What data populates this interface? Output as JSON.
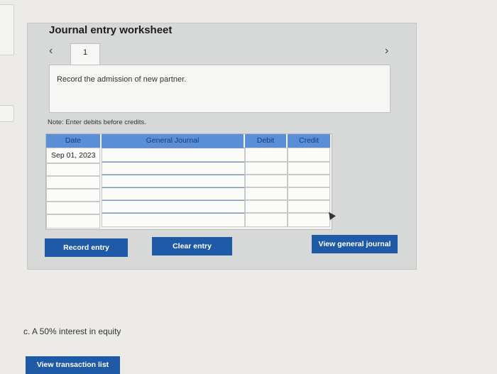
{
  "worksheet": {
    "title": "Journal entry worksheet",
    "prev_icon": "‹",
    "next_icon": "›",
    "page_tab": "1",
    "instruction": "Record the admission of new partner.",
    "note": "Note: Enter debits before credits."
  },
  "journal": {
    "headers": {
      "date": "Date",
      "account": "General Journal",
      "debit": "Debit",
      "credit": "Credit"
    },
    "rows": [
      {
        "date": "Sep 01, 2023",
        "account": "",
        "debit": "",
        "credit": ""
      },
      {
        "date": "",
        "account": "",
        "debit": "",
        "credit": ""
      },
      {
        "date": "",
        "account": "",
        "debit": "",
        "credit": ""
      },
      {
        "date": "",
        "account": "",
        "debit": "",
        "credit": ""
      },
      {
        "date": "",
        "account": "",
        "debit": "",
        "credit": ""
      },
      {
        "date": "",
        "account": "",
        "debit": "",
        "credit": ""
      }
    ]
  },
  "buttons": {
    "record_entry": "Record entry",
    "clear_entry": "Clear entry",
    "view_general_journal": "View general journal",
    "view_transaction_list": "View transaction list"
  },
  "part_c": "c. A 50% interest in equity",
  "colors": {
    "header_blue": "#5a8fd8",
    "button_blue": "#1f5aa6",
    "panel_gray": "#d6d9d7"
  }
}
